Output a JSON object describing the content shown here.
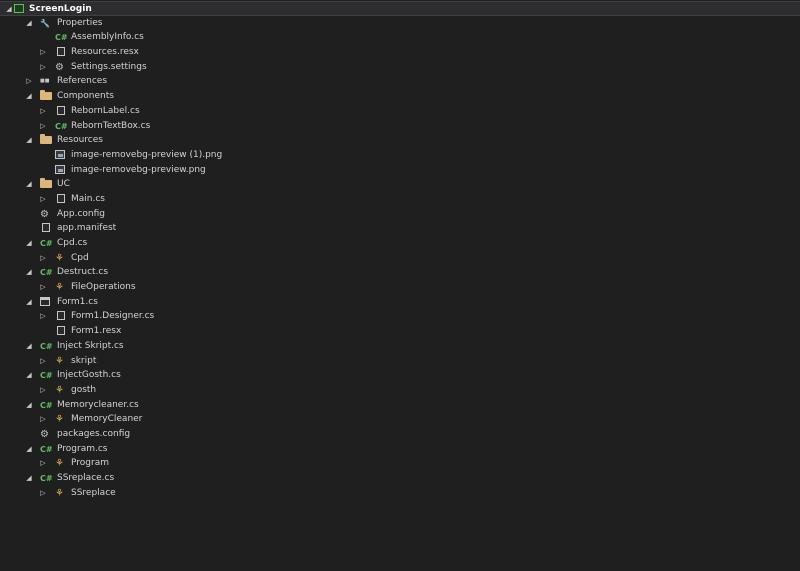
{
  "tree": [
    {
      "label": "ScreenLogin",
      "depth": 0,
      "expander": "expanded",
      "icon": "project-icon",
      "bold": true,
      "selected": true
    },
    {
      "label": "Properties",
      "depth": 1,
      "expander": "expanded",
      "icon": "wrench-icon"
    },
    {
      "label": "AssemblyInfo.cs",
      "depth": 2,
      "expander": "none",
      "icon": "csharp-file-icon"
    },
    {
      "label": "Resources.resx",
      "depth": 2,
      "expander": "collapsed",
      "icon": "resource-file-icon"
    },
    {
      "label": "Settings.settings",
      "depth": 2,
      "expander": "collapsed",
      "icon": "settings-gear-icon"
    },
    {
      "label": "References",
      "depth": 1,
      "expander": "collapsed",
      "icon": "references-icon"
    },
    {
      "label": "Components",
      "depth": 1,
      "expander": "expanded",
      "icon": "folder-icon"
    },
    {
      "label": "RebornLabel.cs",
      "depth": 2,
      "expander": "collapsed",
      "icon": "component-file-icon"
    },
    {
      "label": "RebornTextBox.cs",
      "depth": 2,
      "expander": "collapsed",
      "icon": "csharp-file-icon"
    },
    {
      "label": "Resources",
      "depth": 1,
      "expander": "expanded",
      "icon": "folder-icon"
    },
    {
      "label": "image-removebg-preview (1).png",
      "depth": 2,
      "expander": "none",
      "icon": "image-file-icon"
    },
    {
      "label": "image-removebg-preview.png",
      "depth": 2,
      "expander": "none",
      "icon": "image-file-icon"
    },
    {
      "label": "UC",
      "depth": 1,
      "expander": "expanded",
      "icon": "folder-icon"
    },
    {
      "label": "Main.cs",
      "depth": 2,
      "expander": "collapsed",
      "icon": "usercontrol-file-icon"
    },
    {
      "label": "App.config",
      "depth": 1,
      "expander": "none",
      "icon": "config-file-icon"
    },
    {
      "label": "app.manifest",
      "depth": 1,
      "expander": "none",
      "icon": "manifest-file-icon"
    },
    {
      "label": "Cpd.cs",
      "depth": 1,
      "expander": "expanded",
      "icon": "csharp-file-icon"
    },
    {
      "label": "Cpd",
      "depth": 2,
      "expander": "collapsed",
      "icon": "class-icon"
    },
    {
      "label": "Destruct.cs",
      "depth": 1,
      "expander": "expanded",
      "icon": "csharp-file-icon"
    },
    {
      "label": "FileOperations",
      "depth": 2,
      "expander": "collapsed",
      "icon": "class-icon"
    },
    {
      "label": "Form1.cs",
      "depth": 1,
      "expander": "expanded",
      "icon": "form-file-icon"
    },
    {
      "label": "Form1.Designer.cs",
      "depth": 2,
      "expander": "collapsed",
      "icon": "document-icon"
    },
    {
      "label": "Form1.resx",
      "depth": 2,
      "expander": "none",
      "icon": "document-icon"
    },
    {
      "label": "Inject Skript.cs",
      "depth": 1,
      "expander": "expanded",
      "icon": "csharp-file-icon"
    },
    {
      "label": "skript",
      "depth": 2,
      "expander": "collapsed",
      "icon": "class-icon"
    },
    {
      "label": "InjectGosth.cs",
      "depth": 1,
      "expander": "expanded",
      "icon": "csharp-file-icon"
    },
    {
      "label": "gosth",
      "depth": 2,
      "expander": "collapsed",
      "icon": "class-icon"
    },
    {
      "label": "Memorycleaner.cs",
      "depth": 1,
      "expander": "expanded",
      "icon": "csharp-file-icon"
    },
    {
      "label": "MemoryCleaner",
      "depth": 2,
      "expander": "collapsed",
      "icon": "class-icon"
    },
    {
      "label": "packages.config",
      "depth": 1,
      "expander": "none",
      "icon": "config-file-icon"
    },
    {
      "label": "Program.cs",
      "depth": 1,
      "expander": "expanded",
      "icon": "csharp-file-icon"
    },
    {
      "label": "Program",
      "depth": 2,
      "expander": "collapsed",
      "icon": "class-icon"
    },
    {
      "label": "SSreplace.cs",
      "depth": 1,
      "expander": "expanded",
      "icon": "csharp-file-icon"
    },
    {
      "label": "SSreplace",
      "depth": 2,
      "expander": "collapsed",
      "icon": "class-icon"
    }
  ],
  "glyphs": {
    "expanded": "◢",
    "collapsed": "▷",
    "csharp": "C#",
    "wrench": "🔧",
    "gear": "⚙",
    "class": "⚘",
    "references": "■■",
    "config": "⚙",
    "component": "▤"
  }
}
